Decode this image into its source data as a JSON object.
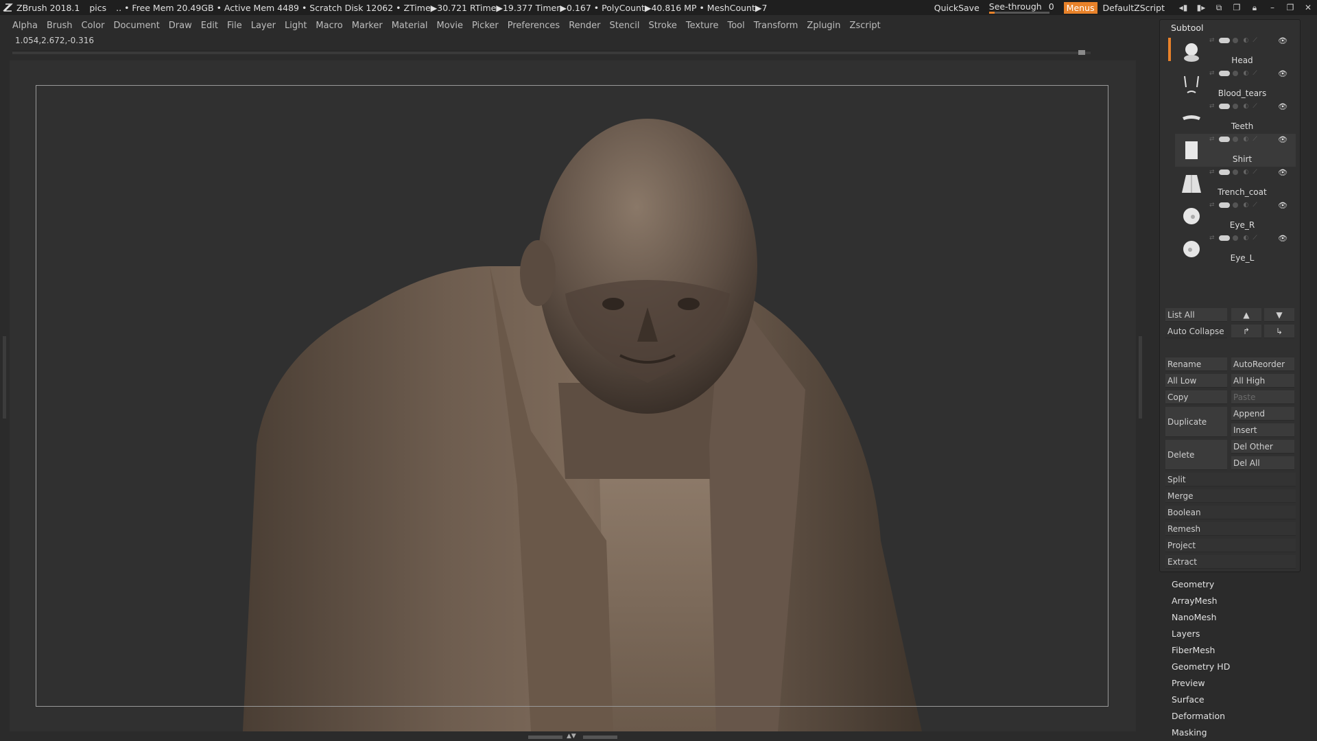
{
  "titlebar": {
    "app": "ZBrush 2018.1",
    "doc": "pics",
    "status": ".. • Free Mem 20.49GB • Active Mem 4489 • Scratch Disk 12062 • ZTime▶30.721 RTime▶19.377 Timer▶0.167 • PolyCount▶40.816 MP • MeshCount▶7",
    "quicksave": "QuickSave",
    "see_through_label": "See-through",
    "see_through_value": "0",
    "menus": "Menus",
    "default_script": "DefaultZScript"
  },
  "menubar": [
    "Alpha",
    "Brush",
    "Color",
    "Document",
    "Draw",
    "Edit",
    "File",
    "Layer",
    "Light",
    "Macro",
    "Marker",
    "Material",
    "Movie",
    "Picker",
    "Preferences",
    "Render",
    "Stencil",
    "Stroke",
    "Texture",
    "Tool",
    "Transform",
    "Zplugin",
    "Zscript"
  ],
  "coords": "1.054,2.672,-0.316",
  "palette": {
    "title": "Subtool",
    "subtools": [
      {
        "name": "Head"
      },
      {
        "name": "Blood_tears"
      },
      {
        "name": "Teeth"
      },
      {
        "name": "Shirt"
      },
      {
        "name": "Trench_coat"
      },
      {
        "name": "Eye_R"
      },
      {
        "name": "Eye_L"
      }
    ],
    "buttons": {
      "list_all": "List All",
      "auto_collapse": "Auto Collapse",
      "rename": "Rename",
      "autoreorder": "AutoReorder",
      "all_low": "All Low",
      "all_high": "All High",
      "copy": "Copy",
      "paste": "Paste",
      "duplicate": "Duplicate",
      "append": "Append",
      "insert": "Insert",
      "delete": "Delete",
      "del_other": "Del Other",
      "del_all": "Del All",
      "split": "Split",
      "merge": "Merge",
      "boolean": "Boolean",
      "remesh": "Remesh",
      "project": "Project",
      "extract": "Extract"
    }
  },
  "subpalettes": [
    "Geometry",
    "ArrayMesh",
    "NanoMesh",
    "Layers",
    "FiberMesh",
    "Geometry HD",
    "Preview",
    "Surface",
    "Deformation",
    "Masking"
  ],
  "colors": {
    "accent": "#e8822a",
    "background": "#2b2b2b"
  }
}
